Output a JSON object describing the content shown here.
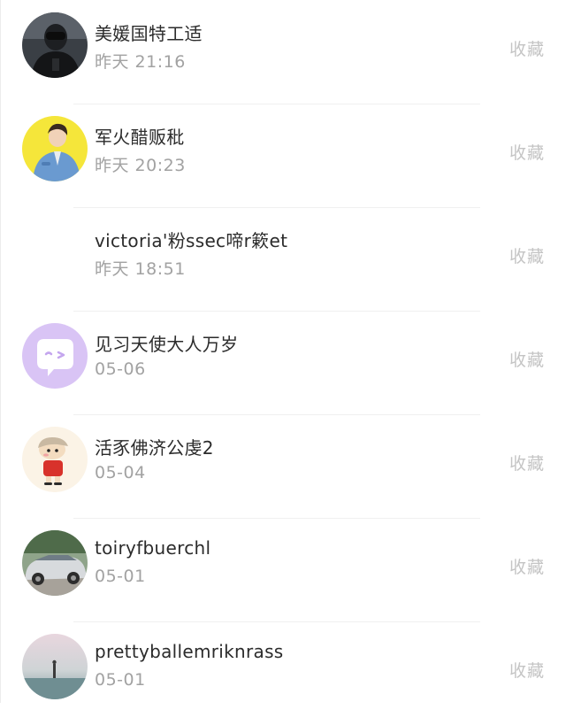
{
  "items": [
    {
      "name": "美媛国特工适",
      "time": "昨天 21:16",
      "action": "收藏",
      "avatar": "dark-portrait-avatar"
    },
    {
      "name": "军火醋贩秕",
      "time": "昨天 20:23",
      "action": "收藏",
      "avatar": "yellow-cartoon-avatar"
    },
    {
      "name": "victoria'粉ssec啼r簌et",
      "time": "昨天 18:51",
      "action": "收藏",
      "avatar": "none"
    },
    {
      "name": "见习天使大人万岁",
      "time": "05-06",
      "action": "收藏",
      "avatar": "purple-chat-bubble-avatar"
    },
    {
      "name": "活豕佛济公虔2",
      "time": "05-04",
      "action": "收藏",
      "avatar": "crayon-boy-avatar"
    },
    {
      "name": "toiryfbuerchl",
      "time": "05-01",
      "action": "收藏",
      "avatar": "car-photo-avatar"
    },
    {
      "name": "prettyballemriknrass",
      "time": "05-01",
      "action": "收藏",
      "avatar": "misty-landscape-avatar"
    }
  ],
  "colors": {
    "name_text": "#2b2b2b",
    "time_text": "#a2a2a2",
    "action_text": "#c4c4c4",
    "divider": "#f0f0f0"
  }
}
